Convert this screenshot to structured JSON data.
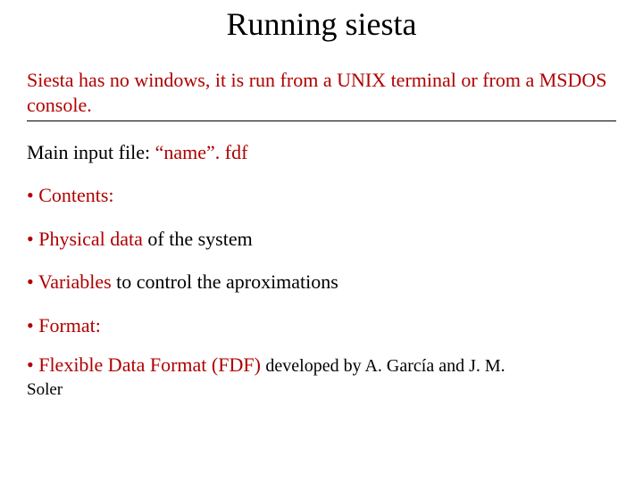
{
  "title": "Running siesta",
  "intro": "Siesta has no windows, it is run from a UNIX terminal or from a MSDOS console.",
  "mainInput_pre": "Main input file: ",
  "mainInput_red": "“name”. fdf",
  "bullet": "• ",
  "contents": "Contents:",
  "physical_red": "Physical data",
  "physical_rest": " of the system",
  "variables_red": "Variables ",
  "variables_rest": "to control the aproximations",
  "format": "Format:",
  "fdf_red": "Flexible Data Format (FDF) ",
  "fdf_rest1": "developed by A. García and J. M. ",
  "fdf_rest2": "Soler"
}
